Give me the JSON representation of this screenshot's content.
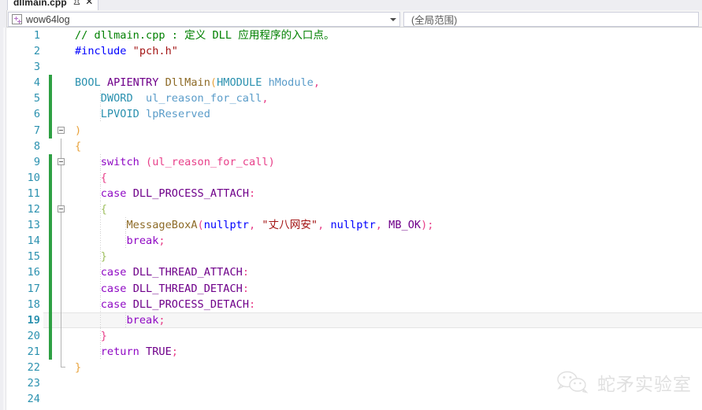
{
  "window": {
    "tab": {
      "title": "dllmain.cpp",
      "pin_icon": "pin-icon",
      "close_icon": "close-icon"
    }
  },
  "navbar": {
    "type_selector": {
      "icon": "namespace-icon",
      "value": "wow64log",
      "dropdown_icon": "chevron-down-icon"
    },
    "member_selector": {
      "value": "(全局范围)"
    }
  },
  "editor": {
    "language": "cpp",
    "current_line": 19,
    "lines": [
      {
        "n": "1",
        "change": false,
        "indent_guides": [],
        "tokens": [
          {
            "t": "// dllmain.cpp : 定义 DLL 应用程序的入口点。",
            "c": "c-comment"
          }
        ]
      },
      {
        "n": "2",
        "change": false,
        "indent_guides": [],
        "tokens": [
          {
            "t": "#include",
            "c": "c-pp"
          },
          {
            "t": " ",
            "c": "c-plain"
          },
          {
            "t": "\"pch.h\"",
            "c": "c-str"
          }
        ]
      },
      {
        "n": "3",
        "change": false,
        "indent_guides": [],
        "tokens": []
      },
      {
        "n": "4",
        "change": true,
        "indent_guides": [],
        "tokens": [
          {
            "t": "BOOL",
            "c": "c-type"
          },
          {
            "t": " ",
            "c": "c-plain"
          },
          {
            "t": "APIENTRY",
            "c": "c-macro"
          },
          {
            "t": " ",
            "c": "c-plain"
          },
          {
            "t": "DllMain",
            "c": "c-func"
          },
          {
            "t": "(",
            "c": "c-punc-orange"
          },
          {
            "t": "HMODULE",
            "c": "c-type"
          },
          {
            "t": " ",
            "c": "c-plain"
          },
          {
            "t": "hModule",
            "c": "c-paramlt"
          },
          {
            "t": ",",
            "c": "c-punc-pink"
          }
        ]
      },
      {
        "n": "5",
        "change": true,
        "indent_guides": [
          4
        ],
        "tokens": [
          {
            "t": "    ",
            "c": "c-plain"
          },
          {
            "t": "DWORD",
            "c": "c-type"
          },
          {
            "t": "  ",
            "c": "c-plain"
          },
          {
            "t": "ul_reason_for_call",
            "c": "c-paramlt"
          },
          {
            "t": ",",
            "c": "c-punc-pink"
          }
        ]
      },
      {
        "n": "6",
        "change": true,
        "indent_guides": [
          4
        ],
        "tokens": [
          {
            "t": "    ",
            "c": "c-plain"
          },
          {
            "t": "LPVOID",
            "c": "c-type"
          },
          {
            "t": " ",
            "c": "c-plain"
          },
          {
            "t": "lpReserved",
            "c": "c-paramlt"
          }
        ]
      },
      {
        "n": "7",
        "change": true,
        "fold": true,
        "indent_guides": [],
        "tokens": [
          {
            "t": ")",
            "c": "c-punc-orange"
          }
        ]
      },
      {
        "n": "8",
        "change": false,
        "foldline": true,
        "indent_guides": [],
        "tokens": [
          {
            "t": "{",
            "c": "c-punc-orange"
          }
        ]
      },
      {
        "n": "9",
        "change": true,
        "fold": true,
        "foldline": true,
        "indent_guides": [
          4
        ],
        "tokens": [
          {
            "t": "    ",
            "c": "c-plain"
          },
          {
            "t": "switch",
            "c": "c-kw-purple"
          },
          {
            "t": " ",
            "c": "c-plain"
          },
          {
            "t": "(",
            "c": "c-punc-pink"
          },
          {
            "t": "ul_reason_for_call",
            "c": "c-var-pink"
          },
          {
            "t": ")",
            "c": "c-punc-pink"
          }
        ]
      },
      {
        "n": "10",
        "change": true,
        "foldline": true,
        "indent_guides": [
          4
        ],
        "tokens": [
          {
            "t": "    ",
            "c": "c-plain"
          },
          {
            "t": "{",
            "c": "c-punc-pink"
          }
        ]
      },
      {
        "n": "11",
        "change": true,
        "foldline": true,
        "indent_guides": [
          4
        ],
        "tokens": [
          {
            "t": "    ",
            "c": "c-plain"
          },
          {
            "t": "case",
            "c": "c-kw-purple"
          },
          {
            "t": " ",
            "c": "c-plain"
          },
          {
            "t": "DLL_PROCESS_ATTACH",
            "c": "c-macro"
          },
          {
            "t": ":",
            "c": "c-punc-pink"
          }
        ]
      },
      {
        "n": "12",
        "change": true,
        "fold": true,
        "foldline": true,
        "indent_guides": [
          4
        ],
        "tokens": [
          {
            "t": "    ",
            "c": "c-plain"
          },
          {
            "t": "{",
            "c": "c-kw-green"
          }
        ]
      },
      {
        "n": "13",
        "change": true,
        "foldline": true,
        "indent_guides": [
          4,
          8
        ],
        "tokens": [
          {
            "t": "        ",
            "c": "c-plain"
          },
          {
            "t": "MessageBoxA",
            "c": "c-func"
          },
          {
            "t": "(",
            "c": "c-punc-pink"
          },
          {
            "t": "nullptr",
            "c": "c-kw"
          },
          {
            "t": ", ",
            "c": "c-punc-pink"
          },
          {
            "t": "\"丈八网安\"",
            "c": "c-str"
          },
          {
            "t": ", ",
            "c": "c-punc-pink"
          },
          {
            "t": "nullptr",
            "c": "c-kw"
          },
          {
            "t": ", ",
            "c": "c-punc-pink"
          },
          {
            "t": "MB_OK",
            "c": "c-macro"
          },
          {
            "t": ")",
            "c": "c-punc-pink"
          },
          {
            "t": ";",
            "c": "c-punc-pink"
          }
        ]
      },
      {
        "n": "14",
        "change": true,
        "foldline": true,
        "indent_guides": [
          4,
          8
        ],
        "tokens": [
          {
            "t": "        ",
            "c": "c-plain"
          },
          {
            "t": "break",
            "c": "c-kw-purple"
          },
          {
            "t": ";",
            "c": "c-punc-pink"
          }
        ]
      },
      {
        "n": "15",
        "change": true,
        "foldline": true,
        "indent_guides": [
          4
        ],
        "tokens": [
          {
            "t": "    ",
            "c": "c-plain"
          },
          {
            "t": "}",
            "c": "c-kw-green"
          }
        ]
      },
      {
        "n": "16",
        "change": true,
        "foldline": true,
        "indent_guides": [
          4
        ],
        "tokens": [
          {
            "t": "    ",
            "c": "c-plain"
          },
          {
            "t": "case",
            "c": "c-kw-purple"
          },
          {
            "t": " ",
            "c": "c-plain"
          },
          {
            "t": "DLL_THREAD_ATTACH",
            "c": "c-macro"
          },
          {
            "t": ":",
            "c": "c-punc-pink"
          }
        ]
      },
      {
        "n": "17",
        "change": true,
        "foldline": true,
        "indent_guides": [
          4
        ],
        "tokens": [
          {
            "t": "    ",
            "c": "c-plain"
          },
          {
            "t": "case",
            "c": "c-kw-purple"
          },
          {
            "t": " ",
            "c": "c-plain"
          },
          {
            "t": "DLL_THREAD_DETACH",
            "c": "c-macro"
          },
          {
            "t": ":",
            "c": "c-punc-pink"
          }
        ]
      },
      {
        "n": "18",
        "change": true,
        "foldline": true,
        "indent_guides": [
          4
        ],
        "tokens": [
          {
            "t": "    ",
            "c": "c-plain"
          },
          {
            "t": "case",
            "c": "c-kw-purple"
          },
          {
            "t": " ",
            "c": "c-plain"
          },
          {
            "t": "DLL_PROCESS_DETACH",
            "c": "c-macro"
          },
          {
            "t": ":",
            "c": "c-punc-pink"
          }
        ]
      },
      {
        "n": "19",
        "change": true,
        "current": true,
        "foldline": true,
        "indent_guides": [
          4,
          8
        ],
        "tokens": [
          {
            "t": "        ",
            "c": "c-plain"
          },
          {
            "t": "break",
            "c": "c-kw-purple"
          },
          {
            "t": ";",
            "c": "c-punc-pink"
          }
        ]
      },
      {
        "n": "20",
        "change": true,
        "foldline": true,
        "indent_guides": [
          4
        ],
        "tokens": [
          {
            "t": "    ",
            "c": "c-plain"
          },
          {
            "t": "}",
            "c": "c-punc-pink"
          }
        ]
      },
      {
        "n": "21",
        "change": true,
        "foldline": true,
        "indent_guides": [
          4
        ],
        "tokens": [
          {
            "t": "    ",
            "c": "c-plain"
          },
          {
            "t": "return",
            "c": "c-kw-purple"
          },
          {
            "t": " ",
            "c": "c-plain"
          },
          {
            "t": "TRUE",
            "c": "c-macro"
          },
          {
            "t": ";",
            "c": "c-punc-pink"
          }
        ]
      },
      {
        "n": "22",
        "change": false,
        "foldend": true,
        "indent_guides": [],
        "tokens": [
          {
            "t": "}",
            "c": "c-punc-orange"
          }
        ]
      },
      {
        "n": "23",
        "change": false,
        "indent_guides": [],
        "tokens": []
      },
      {
        "n": "24",
        "change": false,
        "indent_guides": [],
        "tokens": []
      }
    ]
  },
  "watermark": {
    "logo": "wechat-icon",
    "text": "蛇矛实验室"
  },
  "colors": {
    "comment": "#008000",
    "preprocessor": "#0000ff",
    "string": "#a31515",
    "type": "#2b91af",
    "macro": "#6f008a",
    "function": "#8d6a26",
    "keyword_purple": "#8f08c4",
    "punctuation_pink": "#e8408a",
    "punctuation_orange": "#e8a33d",
    "changebar_green": "#2ea043",
    "linenumber": "#2b91af"
  }
}
